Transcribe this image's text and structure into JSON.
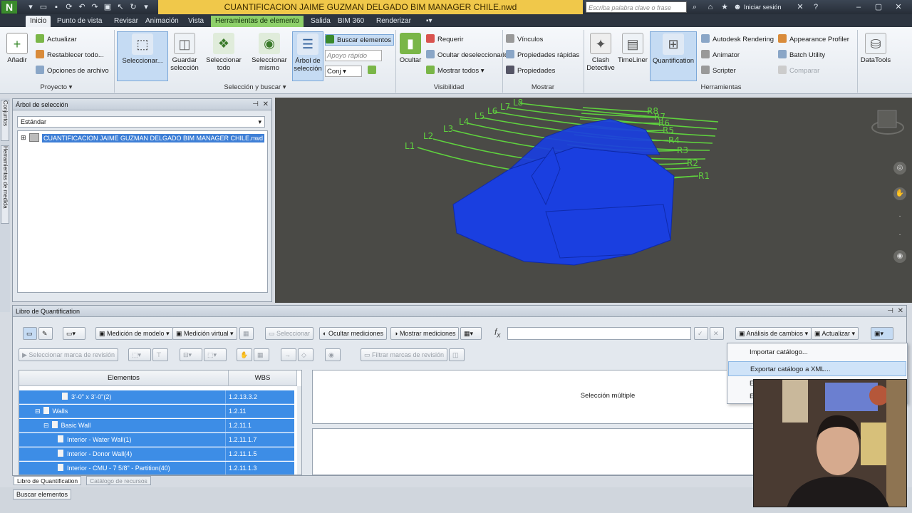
{
  "window": {
    "logo": "N",
    "title": "CUANTIFICACION JAIME GUZMAN DELGADO BIM MANAGER CHILE.nwd",
    "search_placeholder": "Escriba palabra clave o frase",
    "signin": "Iniciar sesión"
  },
  "tabs": [
    "Inicio",
    "Punto de vista",
    "Revisar",
    "Animación",
    "Vista",
    "Herramientas de elemento",
    "Salida",
    "BIM 360",
    "Renderizar"
  ],
  "ribbon": {
    "proyecto": {
      "anadir": "Añadir",
      "actualizar": "Actualizar",
      "restablecer": "Restablecer todo...",
      "opciones": "Opciones de archivo",
      "label": "Proyecto"
    },
    "seleccion": {
      "seleccionar": "Seleccionar...",
      "guardar": "Guardar selección",
      "sel_todo": "Seleccionar todo",
      "sel_mismo": "Seleccionar mismo",
      "arbol": "Árbol de selección",
      "buscar": "Buscar elementos",
      "apoyo": "Apoyo rápido",
      "set": "Conj",
      "label": "Selección y buscar"
    },
    "visibilidad": {
      "ocultar": "Ocultar",
      "requerir": "Requerir",
      "ocultar_desel": "Ocultar deseleccionado",
      "mostrar_todos": "Mostrar todos",
      "label": "Visibilidad"
    },
    "mostrar": {
      "vinculos": "Vínculos",
      "prop_rapidas": "Propiedades rápidas",
      "propiedades": "Propiedades",
      "label": "Mostrar"
    },
    "herramientas": {
      "clash": "Clash Detective",
      "timeliner": "TimeLiner",
      "quantification": "Quantification",
      "rendering": "Autodesk Rendering",
      "animator": "Animator",
      "scripter": "Scripter",
      "appearance": "Appearance Profiler",
      "batch": "Batch Utility",
      "comparar": "Comparar",
      "datatools": "DataTools",
      "label": "Herramientas"
    }
  },
  "side_tabs": [
    "Conjuntos",
    "Herramientas de medida"
  ],
  "tree": {
    "title": "Árbol de selección",
    "dropdown": "Estándar",
    "item": "CUANTIFICACION JAIME GUZMAN DELGADO BIM MANAGER CHILE.nwd"
  },
  "viewport": {
    "grids": [
      "L1",
      "L2",
      "L3",
      "L4",
      "L5",
      "L6",
      "L7",
      "L8",
      "R1",
      "R2",
      "R3",
      "R4",
      "R5",
      "R6",
      "R7",
      "R8"
    ]
  },
  "quant": {
    "title": "Libro de Quantification",
    "btn_medicion_modelo": "Medición de modelo",
    "btn_medicion_virtual": "Medición virtual",
    "btn_seleccionar": "Seleccionar",
    "btn_ocultar_med": "Ocultar mediciones",
    "btn_mostrar_med": "Mostrar mediciones",
    "btn_analisis": "Análisis de cambios",
    "btn_actualizar": "Actualizar",
    "btn_sel_marca": "Seleccionar marca de revisión",
    "btn_filtrar": "Filtrar marcas de revisión",
    "col_elementos": "Elementos",
    "col_wbs": "WBS",
    "rows": [
      {
        "name": "3'-0\" x 3'-0\"(2)",
        "wbs": "1.2.13.3.2"
      },
      {
        "name": "Walls",
        "wbs": "1.2.11"
      },
      {
        "name": "Basic Wall",
        "wbs": "1.2.11.1"
      },
      {
        "name": "Interior - Water Wall(1)",
        "wbs": "1.2.11.1.7"
      },
      {
        "name": "Interior - Donor Wall(4)",
        "wbs": "1.2.11.1.5"
      },
      {
        "name": "Interior - CMU - 7 5/8\" - Partition(40)",
        "wbs": "1.2.11.1.3"
      }
    ],
    "multi": "Selección múltiple",
    "menu": [
      "Importar catálogo...",
      "Exportar catálogo a XML...",
      "E",
      "E"
    ]
  },
  "bottom_tabs": [
    "Libro de Quantification",
    "Catálogo de recursos"
  ],
  "status_button": "Buscar elementos",
  "colors": {
    "model": "#1a3fe0",
    "grid": "#5fd23e",
    "selection": "#3d8de6",
    "title_bg": "#f0c84a"
  }
}
